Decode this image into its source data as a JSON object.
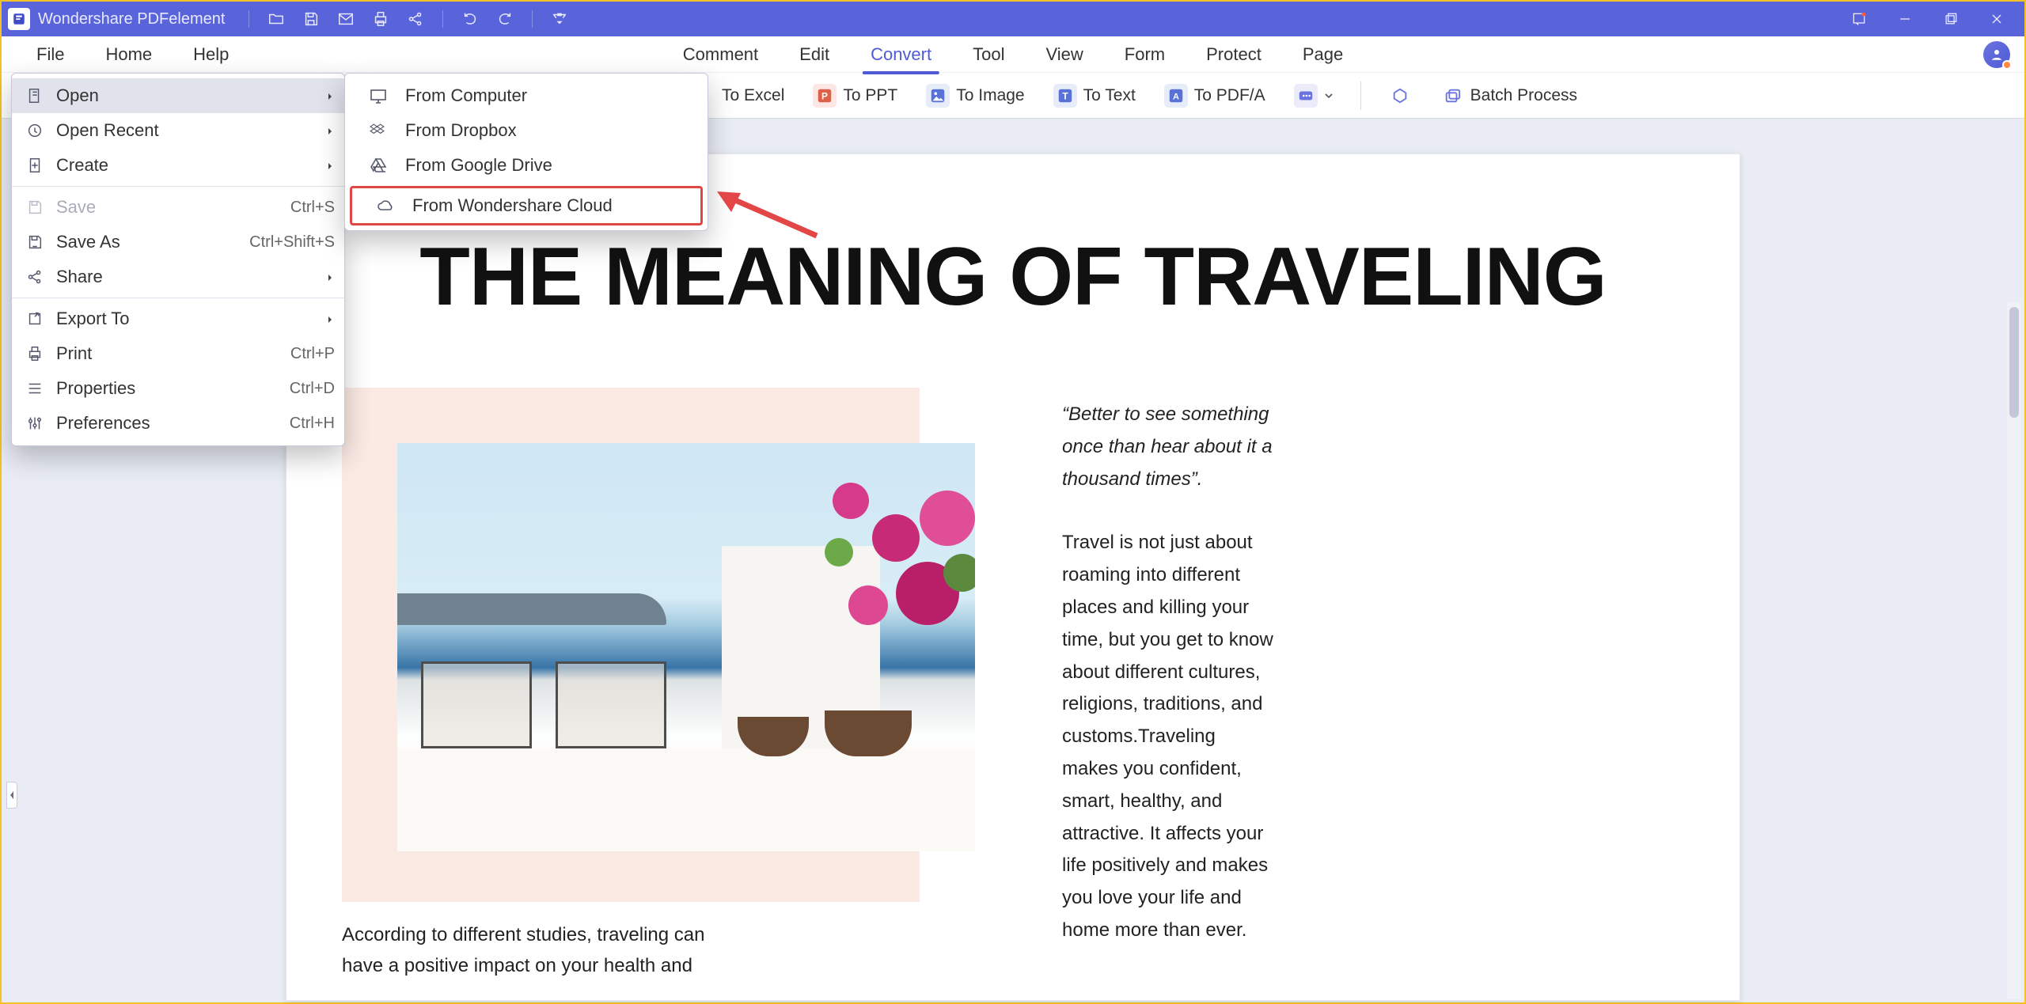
{
  "titlebar": {
    "app_name": "Wondershare PDFelement"
  },
  "menubar": {
    "left": [
      "File",
      "Home",
      "Help"
    ],
    "center": [
      "Comment",
      "Edit",
      "Convert",
      "Tool",
      "View",
      "Form",
      "Protect",
      "Page"
    ],
    "active": "Convert"
  },
  "ribbon": {
    "to_excel": "To Excel",
    "to_ppt": "To PPT",
    "to_image": "To Image",
    "to_text": "To Text",
    "to_pdfa": "To PDF/A",
    "batch": "Batch Process"
  },
  "file_menu": {
    "open": {
      "label": "Open"
    },
    "open_recent": {
      "label": "Open Recent"
    },
    "create": {
      "label": "Create"
    },
    "save": {
      "label": "Save",
      "shortcut": "Ctrl+S"
    },
    "save_as": {
      "label": "Save As",
      "shortcut": "Ctrl+Shift+S"
    },
    "share": {
      "label": "Share"
    },
    "export_to": {
      "label": "Export To"
    },
    "print": {
      "label": "Print",
      "shortcut": "Ctrl+P"
    },
    "properties": {
      "label": "Properties",
      "shortcut": "Ctrl+D"
    },
    "preferences": {
      "label": "Preferences",
      "shortcut": "Ctrl+H"
    }
  },
  "open_submenu": {
    "from_computer": "From Computer",
    "from_dropbox": "From Dropbox",
    "from_gdrive": "From Google Drive",
    "from_wondershare": "From Wondershare Cloud"
  },
  "document": {
    "heading": "THE MEANING OF TRAVELING",
    "quote": "“Better to see something once than hear about it a thousand times”.",
    "body": "Travel is not just about roaming into different places and killing your time, but you get to know about different cultures, religions, traditions, and customs.Traveling makes you confident, smart, healthy, and attractive. It affects your life positively and makes you love your life and home more than ever.",
    "bottom": "According to different studies, traveling can have a positive impact on your health and"
  }
}
